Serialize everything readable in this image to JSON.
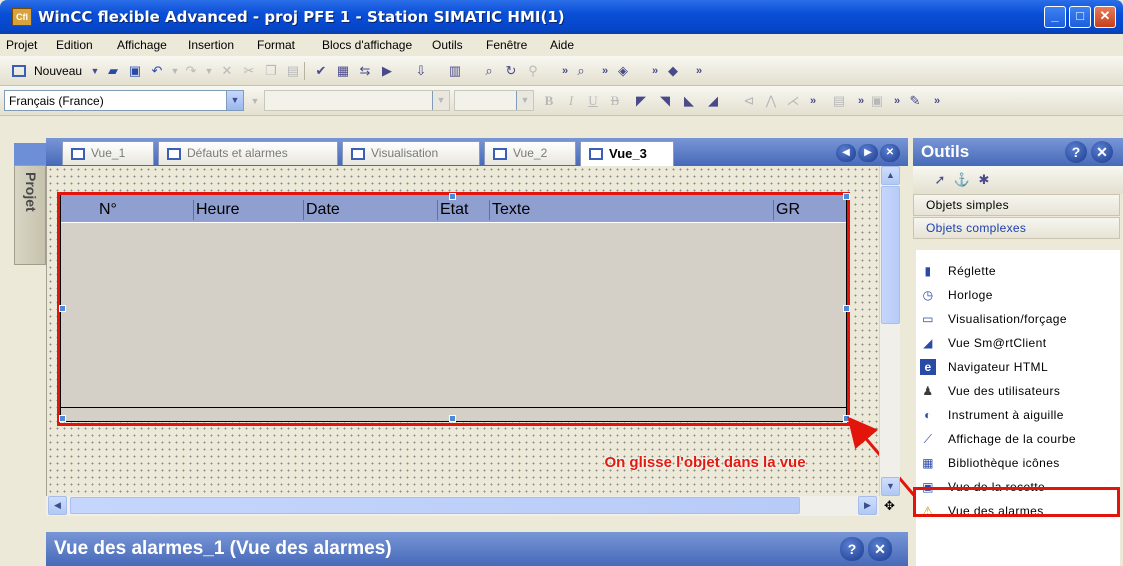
{
  "window": {
    "app_icon_text": "Cfl",
    "title": "WinCC flexible Advanced - proj PFE 1 - Station SIMATIC HMI(1)",
    "controls": {
      "minimize": "_",
      "maximize": "□",
      "close": "✕"
    }
  },
  "menubar": [
    "Projet",
    "Edition",
    "Affichage",
    "Insertion",
    "Format",
    "Blocs d'affichage",
    "Outils",
    "Fenêtre",
    "Aide"
  ],
  "toolbar1": {
    "new_label": "Nouveau"
  },
  "toolbar2": {
    "language": "Français (France)",
    "bold": "B",
    "italic": "I",
    "underline": "U",
    "strike": "B"
  },
  "sidebar": {
    "project_tab": "Projet"
  },
  "editor": {
    "tabs": [
      {
        "label": "Vue_1",
        "active": false
      },
      {
        "label": "Défauts et alarmes",
        "active": false
      },
      {
        "label": "Visualisation",
        "active": false
      },
      {
        "label": "Vue_2",
        "active": false
      },
      {
        "label": "Vue_3",
        "active": true
      }
    ],
    "alarm_view_columns": [
      "N°",
      "Heure",
      "Date",
      "Etat",
      "Texte",
      "GR"
    ],
    "annotation": "On glisse l'objet dans la vue"
  },
  "tools": {
    "title": "Outils",
    "categories": [
      "Objets simples",
      "Objets complexes"
    ],
    "items": [
      {
        "label": "Réglette",
        "icon": "ruler-icon"
      },
      {
        "label": "Horloge",
        "icon": "clock-icon"
      },
      {
        "label": "Visualisation/forçage",
        "icon": "monitor-table-icon"
      },
      {
        "label": "Vue Sm@rtClient",
        "icon": "smartclient-icon"
      },
      {
        "label": "Navigateur HTML",
        "icon": "browser-icon"
      },
      {
        "label": "Vue des utilisateurs",
        "icon": "user-icon"
      },
      {
        "label": "Instrument à aiguille",
        "icon": "gauge-icon"
      },
      {
        "label": "Affichage de la courbe",
        "icon": "trend-icon"
      },
      {
        "label": "Bibliothèque icônes",
        "icon": "icon-library-icon"
      },
      {
        "label": "Vue de la recette",
        "icon": "recipe-icon"
      },
      {
        "label": "Vue des alarmes",
        "icon": "alarm-warning-icon",
        "highlighted": true
      }
    ]
  },
  "properties": {
    "title": "Vue des alarmes_1 (Vue des alarmes)"
  },
  "colors": {
    "accent": "#0a4fd8",
    "highlight": "#e3140c",
    "header": "#8f9fd0"
  }
}
